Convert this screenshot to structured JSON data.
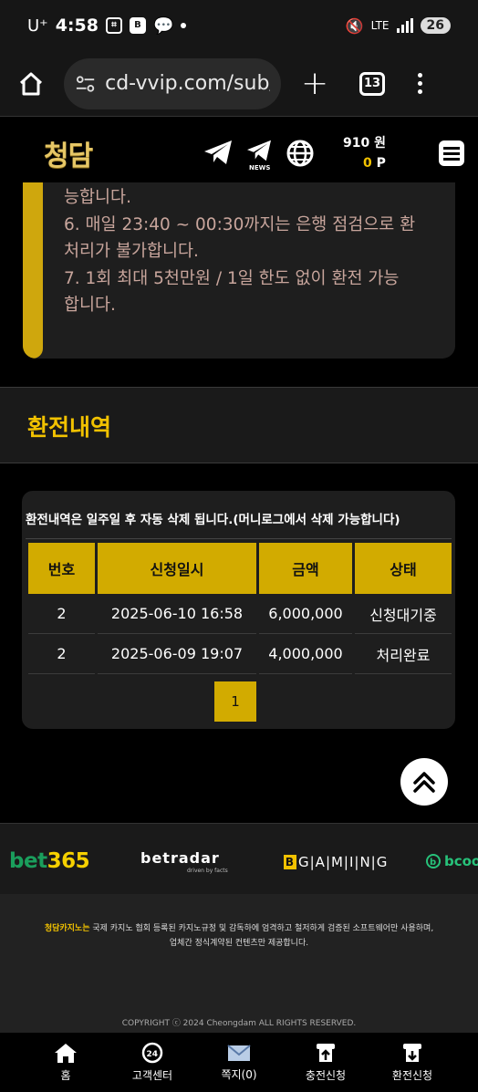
{
  "status_bar": {
    "carrier": "U⁺",
    "time": "4:58",
    "network": "LTE",
    "battery": "26",
    "app_icon_label": "B"
  },
  "browser": {
    "url": "cd-vvip.com/sub/",
    "tab_count": "13"
  },
  "header": {
    "logo": "청담",
    "news_label": "NEWS",
    "balance": "910 원",
    "points_value": "0",
    "points_unit": "P"
  },
  "notice": {
    "lines": [
      "능합니다.",
      "6. 매일 23:40 ~ 00:30까지는 은행 점검으로 환",
      "처리가 불가합니다.",
      "7. 1회 최대 5천만원 / 1일 한도 없이 환전 가능",
      "합니다."
    ]
  },
  "section": {
    "title": "환전내역"
  },
  "history": {
    "notice": "환전내역은 일주일 후 자동 삭제 됩니다.(머니로그에서 삭제 가능합니다)",
    "columns": [
      "번호",
      "신청일시",
      "금액",
      "상태"
    ],
    "rows": [
      [
        "2",
        "2025-06-10 16:58",
        "6,000,000",
        "신청대기중"
      ],
      [
        "2",
        "2025-06-09 19:07",
        "4,000,000",
        "처리완료"
      ]
    ],
    "current_page": "1"
  },
  "partners": {
    "bet365_a": "bet",
    "bet365_b": "365",
    "betradar": "betradar",
    "betradar_sub": "driven by facts",
    "bgaming_b": "B",
    "bgaming_rest": "G|A|M|I|N|G",
    "bcoo": "bcoo"
  },
  "footer": {
    "brand": "청담카지노는",
    "desc_line1": " 국제 카지노 협회 등록된 카지노규정 및 감독하에 엄격하고 철저하게 검증된 소프트웨어만 사용하며,",
    "desc_line2": "업체간 정식계약된 컨텐츠만 제공합니다.",
    "copyright": "COPYRIGHT ⓒ 2024 Cheongdam ALL RIGHTS RESERVED."
  },
  "bottom_nav": {
    "items": [
      {
        "label": "홈",
        "icon": "home-icon"
      },
      {
        "label": "고객센터",
        "icon": "support-24-icon"
      },
      {
        "label": "쪽지(0)",
        "icon": "mail-icon"
      },
      {
        "label": "충전신청",
        "icon": "deposit-icon"
      },
      {
        "label": "환전신청",
        "icon": "withdraw-icon"
      }
    ]
  },
  "colors": {
    "accent_gold": "#d2ab00",
    "title_gold": "#f2c200",
    "notice_text": "#c8a59c"
  }
}
